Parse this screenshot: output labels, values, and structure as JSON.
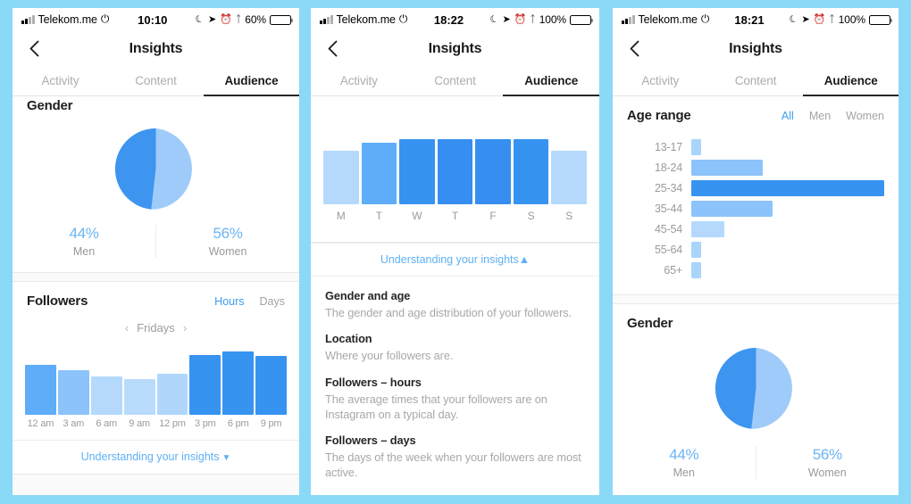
{
  "background_color": "#8ad9f6",
  "colors": {
    "brand_blue": "#3e9bf0",
    "bar_dark": "#3693f0",
    "bar_mid": "#5facf8",
    "bar_light": "#a9d4fb",
    "bar_lightest": "#bcddfc",
    "pie_men": "#3e95ef",
    "pie_women": "#9fcbfa",
    "link_blue": "#5fb0f2",
    "muted_text": "#9b9b9b"
  },
  "phones": [
    {
      "id": "phone-1",
      "status_bar": {
        "carrier": "Telekom.me",
        "time": "10:10",
        "battery_percent": "60%",
        "battery_level": 60,
        "icons": [
          "signal-icon",
          "wifi-icon",
          "moon-icon",
          "location-arrow-icon",
          "alarm-clock-icon",
          "bluetooth-icon",
          "battery-icon"
        ]
      },
      "nav": {
        "title": "Insights",
        "back_icon": "chevron-left-icon"
      },
      "tabs": [
        {
          "label": "Activity",
          "active": false
        },
        {
          "label": "Content",
          "active": false
        },
        {
          "label": "Audience",
          "active": true
        }
      ],
      "gender_card": {
        "title": "Gender",
        "men_percent": "44%",
        "men_label": "Men",
        "women_percent": "56%",
        "women_label": "Women"
      },
      "followers_card": {
        "title": "Followers",
        "segment": {
          "hours": "Hours",
          "days": "Days",
          "selected": "Hours"
        },
        "day_nav": {
          "prev": "‹",
          "value": "Fridays",
          "next": "›"
        },
        "footer_link": "Understanding your insights",
        "footer_chevron": "chevron-down-icon"
      }
    },
    {
      "id": "phone-2",
      "status_bar": {
        "carrier": "Telekom.me",
        "time": "18:22",
        "battery_percent": "100%",
        "battery_level": 100,
        "icons": [
          "signal-icon",
          "wifi-icon",
          "moon-icon",
          "location-arrow-icon",
          "alarm-clock-icon",
          "bluetooth-icon",
          "battery-icon"
        ]
      },
      "nav": {
        "title": "Insights",
        "back_icon": "chevron-left-icon"
      },
      "tabs": [
        {
          "label": "Activity",
          "active": false
        },
        {
          "label": "Content",
          "active": false
        },
        {
          "label": "Audience",
          "active": true
        }
      ],
      "expand_link": "Understanding your insights",
      "expand_chevron": "chevron-up-icon",
      "glossary": [
        {
          "term": "Gender and age",
          "definition": "The gender and age distribution of your followers."
        },
        {
          "term": "Location",
          "definition": "Where your followers are."
        },
        {
          "term": "Followers – hours",
          "definition": "The average times that your followers are on Instagram on a typical day."
        },
        {
          "term": "Followers – days",
          "definition": "The days of the week when your followers are most active."
        }
      ]
    },
    {
      "id": "phone-3",
      "status_bar": {
        "carrier": "Telekom.me",
        "time": "18:21",
        "battery_percent": "100%",
        "battery_level": 100,
        "icons": [
          "signal-icon",
          "wifi-icon",
          "moon-icon",
          "location-arrow-icon",
          "alarm-clock-icon",
          "bluetooth-icon",
          "battery-icon"
        ]
      },
      "nav": {
        "title": "Insights",
        "back_icon": "chevron-left-icon"
      },
      "tabs": [
        {
          "label": "Activity",
          "active": false
        },
        {
          "label": "Content",
          "active": false
        },
        {
          "label": "Audience",
          "active": true
        }
      ],
      "age_card": {
        "title": "Age range",
        "filters": [
          {
            "label": "All",
            "active": true
          },
          {
            "label": "Men",
            "active": false
          },
          {
            "label": "Women",
            "active": false
          }
        ]
      },
      "gender_card": {
        "title": "Gender",
        "men_percent": "44%",
        "men_label": "Men",
        "women_percent": "56%",
        "women_label": "Women"
      }
    }
  ],
  "chart_data": [
    {
      "id": "gender-pie-1",
      "type": "pie",
      "title": "Gender",
      "labels": [
        "Men",
        "Women"
      ],
      "values": [
        44,
        56
      ],
      "value_labels": [
        "44%",
        "56%"
      ],
      "colors": [
        "#3e95ef",
        "#9fcbfa"
      ],
      "legend": "below",
      "start_angle_deg": 0
    },
    {
      "id": "followers-hours-1",
      "type": "bar",
      "title": "Followers – hours",
      "subtitle": "Fridays",
      "xlabel": "",
      "ylabel": "",
      "grid": false,
      "categories": [
        "12 am",
        "3 am",
        "6 am",
        "9 am",
        "12 pm",
        "3 pm",
        "6 pm",
        "9 pm"
      ],
      "values": [
        74,
        66,
        56,
        52,
        60,
        88,
        94,
        87
      ],
      "ylim": [
        0,
        100
      ],
      "bar_colors": [
        "#5facf8",
        "#8cc3fa",
        "#b4d9fc",
        "#b9dbfc",
        "#b0d6fb",
        "#3693f0",
        "#3693f0",
        "#3693f0"
      ]
    },
    {
      "id": "followers-days-2",
      "type": "bar",
      "title": "Followers – days",
      "xlabel": "",
      "ylabel": "",
      "grid": false,
      "categories": [
        "M",
        "T",
        "W",
        "T",
        "F",
        "S",
        "S"
      ],
      "values": [
        82,
        94,
        100,
        100,
        100,
        100,
        82
      ],
      "ylim": [
        0,
        100
      ],
      "bar_colors": [
        "#b4d9fc",
        "#5facf8",
        "#3693f0",
        "#368ff0",
        "#368ff0",
        "#3693f0",
        "#b4d9fc"
      ]
    },
    {
      "id": "age-range-3",
      "type": "bar",
      "orientation": "horizontal",
      "title": "Age range",
      "xlabel": "",
      "ylabel": "",
      "grid": false,
      "categories": [
        "13-17",
        "18-24",
        "25-34",
        "35-44",
        "45-54",
        "55-64",
        "65+"
      ],
      "values": [
        5,
        37,
        100,
        42,
        17,
        5,
        5
      ],
      "xlim": [
        0,
        100
      ],
      "bar_colors": [
        "#a9d4fb",
        "#8cc3fa",
        "#3693f0",
        "#8cc3fa",
        "#b4d9fc",
        "#a9d4fb",
        "#a9d4fb"
      ]
    },
    {
      "id": "gender-pie-3",
      "type": "pie",
      "title": "Gender",
      "labels": [
        "Men",
        "Women"
      ],
      "values": [
        44,
        56
      ],
      "value_labels": [
        "44%",
        "56%"
      ],
      "colors": [
        "#3e95ef",
        "#9fcbfa"
      ],
      "legend": "below"
    }
  ]
}
